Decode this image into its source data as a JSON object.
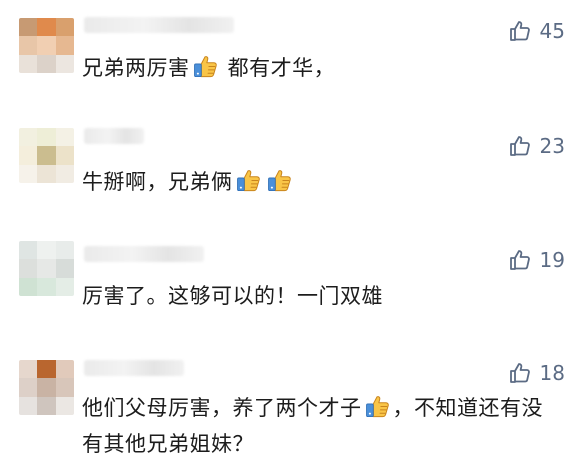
{
  "comments": [
    {
      "likes": "45",
      "text_before": "兄弟两厉害",
      "emoji_count": 1,
      "text_after": " 都有才华，",
      "avatar_colors": [
        "#c79a73",
        "#e08a4c",
        "#d9a06d",
        "#e8c6a8",
        "#f1cfb2",
        "#e6b891",
        "#e9e1d9",
        "#dcd2c9",
        "#ece6e0"
      ]
    },
    {
      "likes": "23",
      "text_before": "牛掰啊，兄弟俩",
      "emoji_count": 2,
      "text_after": "",
      "avatar_colors": [
        "#f2f0e0",
        "#eeeed7",
        "#f4f1e5",
        "#f4eedc",
        "#cbbd8f",
        "#ece2c9",
        "#f6f2ea",
        "#ece4d6",
        "#f1ece3"
      ]
    },
    {
      "likes": "19",
      "text_before": "厉害了。这够可以的！一门双雄",
      "emoji_count": 0,
      "text_after": "",
      "avatar_colors": [
        "#dfe5e3",
        "#eef1ef",
        "#e8ecea",
        "#dcdfdc",
        "#e6e8e6",
        "#d7dcd9",
        "#cfe2d3",
        "#d8e8dc",
        "#e4ede6"
      ]
    },
    {
      "likes": "18",
      "text_before": "他们父母厉害，养了两个才子",
      "emoji_count": 1,
      "text_after": "，不知道还有没有其他兄弟姐妹？",
      "avatar_colors": [
        "#e6d7cd",
        "#b9662f",
        "#e1cabb",
        "#ddd0c8",
        "#c9b3a4",
        "#d8c6ba",
        "#e6e2df",
        "#cfc5be",
        "#ebe7e3"
      ]
    }
  ],
  "icons": {
    "like": "thumbs-up-outline-icon",
    "emoji": "thumbs-up-emoji-icon"
  },
  "colors": {
    "like_text": "#5b6b84",
    "comment_text": "#1c1c1c"
  }
}
